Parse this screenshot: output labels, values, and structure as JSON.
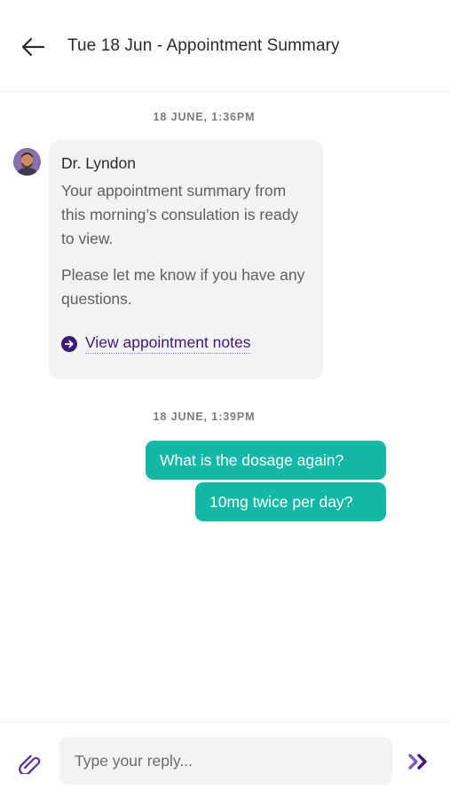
{
  "header": {
    "back_icon": "arrow-left-icon",
    "title": "Tue 18 Jun - Appointment Summary"
  },
  "conversation": {
    "timestamps": [
      "18 JUNE, 1:36PM",
      "18 JUNE, 1:39PM"
    ],
    "incoming": {
      "avatar_icon": "doctor-avatar",
      "sender": "Dr. Lyndon",
      "paragraph_1": "Your appointment summary from this morning’s consulation is ready to view.",
      "paragraph_2": "Please let me know if you have any questions.",
      "link_icon": "arrow-circle-right-icon",
      "link_label": "View appointment notes"
    },
    "outgoing": [
      "What is the dosage again?",
      "10mg twice per day?"
    ]
  },
  "composer": {
    "attach_icon": "paperclip-icon",
    "placeholder": "Type your reply...",
    "value": "",
    "send_icon": "send-chevrons-icon"
  },
  "colors": {
    "accent_purple": "#3d1a78",
    "outgoing_bubble": "#14b8a6",
    "incoming_bubble": "#f3f3f5"
  }
}
